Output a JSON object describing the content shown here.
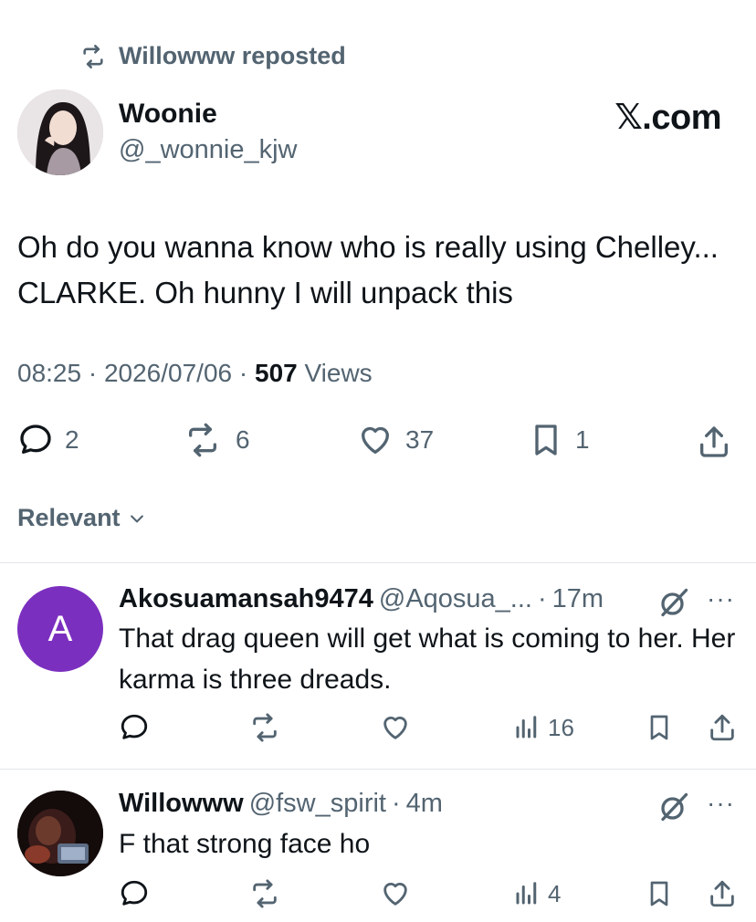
{
  "repost": {
    "label": "Willowww reposted",
    "icon": "repost-icon"
  },
  "main_post": {
    "author_name": "Woonie",
    "author_handle": "@_wonnie_kjw",
    "source_badge": "𝕏.com",
    "text": "Oh do you wanna know who is really using Chelley... CLARKE. Oh hunny I will unpack this",
    "time": "08:25",
    "date": "2026/07/06",
    "views_count": "507",
    "views_label": "Views",
    "stats": {
      "replies": "2",
      "reposts": "6",
      "likes": "37",
      "bookmarks": "1"
    }
  },
  "sort": {
    "label": "Relevant",
    "icon": "chevron-down-icon"
  },
  "replies": [
    {
      "avatar_letter": "A",
      "avatar_color": "#7b2fbf",
      "name": "Akosuamansah9474",
      "handle": "@Aqosua_...",
      "time": "17m",
      "text": "That drag queen will get what is coming to her. Her karma is three dreads.",
      "views": "16"
    },
    {
      "name": "Willowww",
      "handle": "@fsw_spirit",
      "time": "4m",
      "text": "F that strong face ho",
      "views": "4"
    }
  ],
  "separator": "·",
  "more_label": "···",
  "colors": {
    "text": "#0f1419",
    "secondary": "#536471",
    "divider": "#e1e6ea"
  }
}
